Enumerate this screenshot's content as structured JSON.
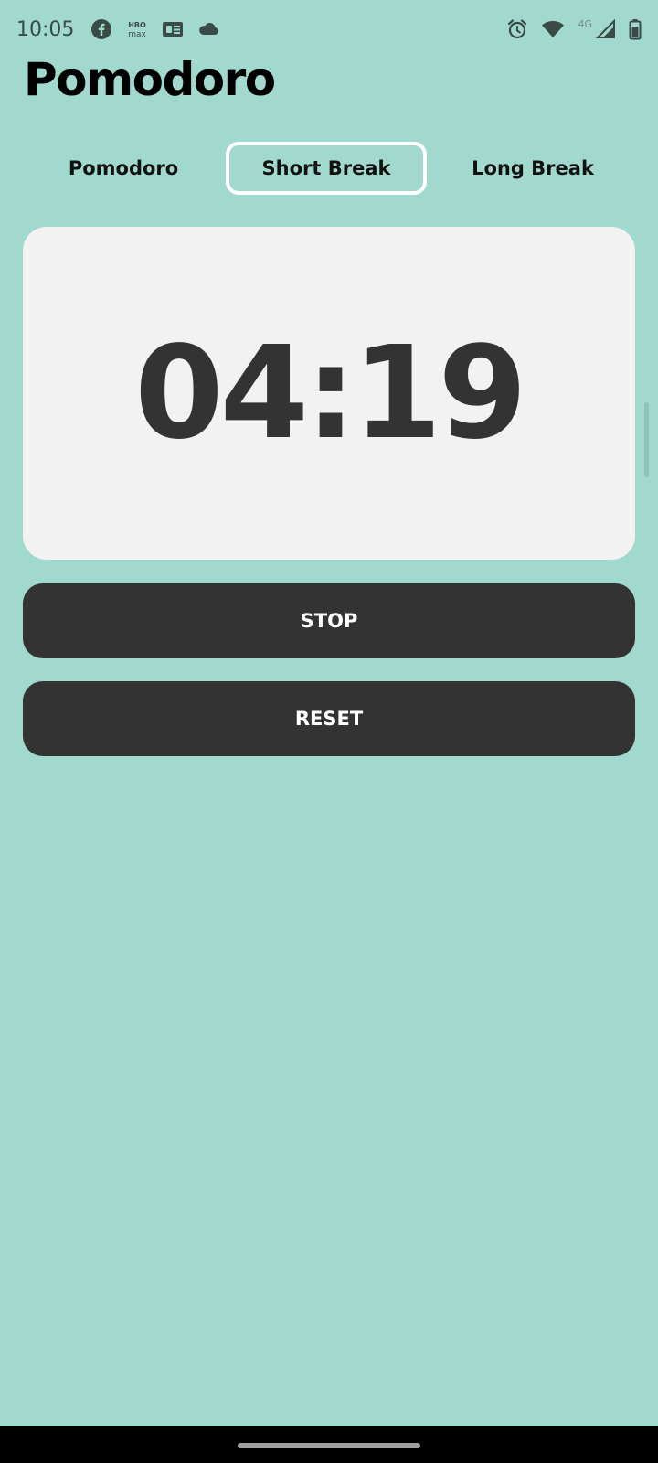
{
  "status_bar": {
    "time": "10:05",
    "left_icons": [
      "facebook-icon",
      "hbo-max-icon",
      "google-news-icon",
      "cloud-icon"
    ],
    "hbo_label_top": "HBO",
    "hbo_label_bottom": "max",
    "network_label": "4G",
    "right_icons": [
      "alarm-icon",
      "wifi-icon",
      "cellular-signal-icon",
      "battery-icon"
    ]
  },
  "header": {
    "title": "Pomodoro"
  },
  "tabs": [
    {
      "label": "Pomodoro",
      "selected": false
    },
    {
      "label": "Short Break",
      "selected": true
    },
    {
      "label": "Long Break",
      "selected": false
    }
  ],
  "timer": {
    "display": "04:19"
  },
  "actions": {
    "stop_label": "STOP",
    "reset_label": "RESET"
  },
  "colors": {
    "background": "#a2d9cf",
    "card": "#f2f2f2",
    "button": "#333333",
    "timer_text": "#333333",
    "selected_tab_border": "#ffffff"
  }
}
